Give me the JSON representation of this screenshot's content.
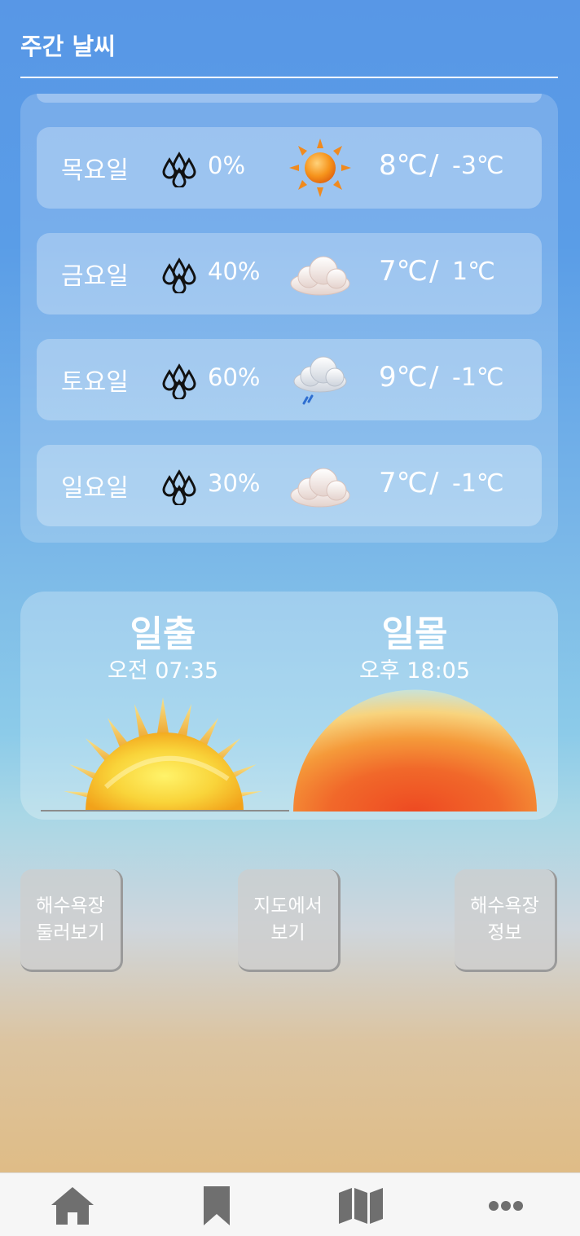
{
  "header": {
    "title": "주간 날씨"
  },
  "weekly": [
    {
      "day": "목요일",
      "rain": "0%",
      "icon": "sun-icon",
      "high": "8℃",
      "sep": "/",
      "low": "-3℃"
    },
    {
      "day": "금요일",
      "rain": "40%",
      "icon": "cloud-icon",
      "high": "7℃",
      "sep": "/",
      "low": "1℃"
    },
    {
      "day": "토요일",
      "rain": "60%",
      "icon": "cloud-rain-snow-icon",
      "high": "9℃",
      "sep": "/",
      "low": "-1℃"
    },
    {
      "day": "일요일",
      "rain": "30%",
      "icon": "cloud-icon",
      "high": "7℃",
      "sep": "/",
      "low": "-1℃"
    }
  ],
  "sun": {
    "sunrise_label": "일출",
    "sunrise_time": "오전 07:35",
    "sunset_label": "일몰",
    "sunset_time": "오후 18:05"
  },
  "actions": [
    {
      "line1": "해수욕장",
      "line2": "둘러보기"
    },
    {
      "line1": "지도에서",
      "line2": "보기"
    },
    {
      "line1": "해수욕장",
      "line2": "정보"
    }
  ],
  "nav": [
    "home-icon",
    "bookmark-icon",
    "map-icon",
    "more-icon"
  ],
  "colors": {
    "nav_icon": "#6f6f6f",
    "raindrop": "#111111"
  }
}
